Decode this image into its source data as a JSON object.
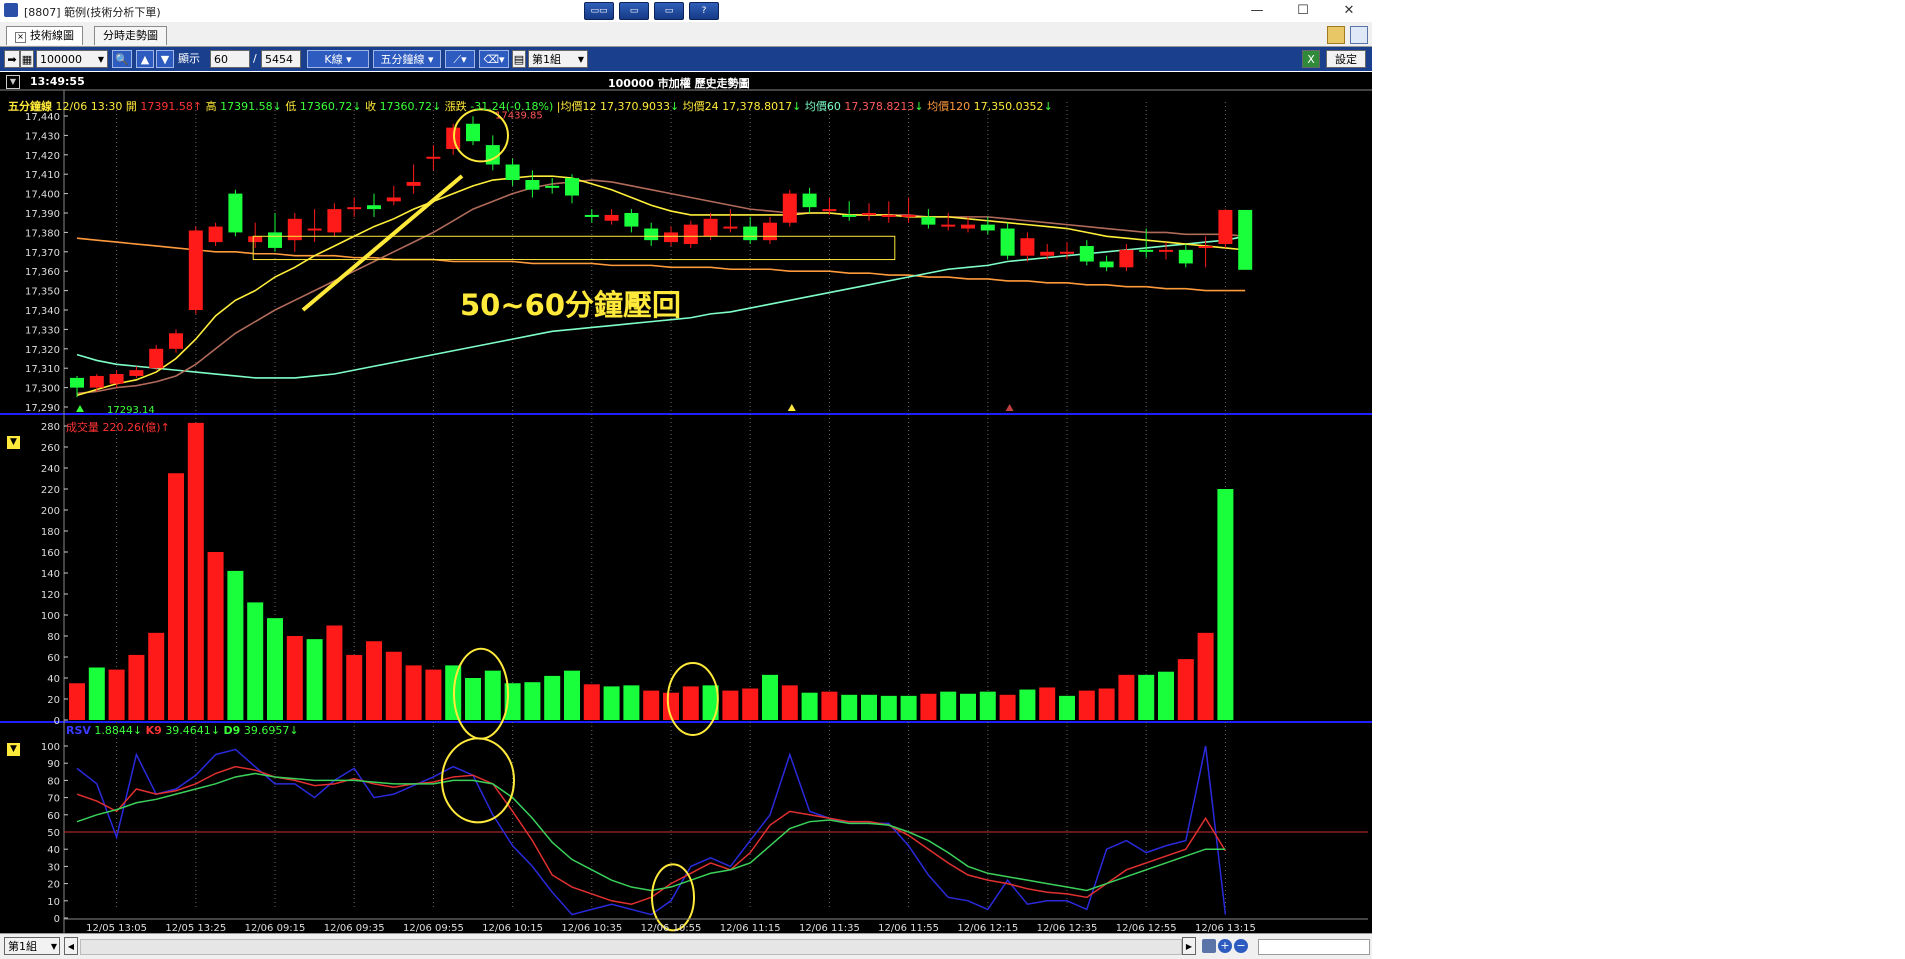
{
  "window": {
    "title": "[8807] 範例(技術分析下單)"
  },
  "title_buttons": [
    "▭▭",
    "▭",
    "▭",
    "?"
  ],
  "tabs": [
    "技術線圖",
    "分時走勢圖"
  ],
  "toolbar": {
    "symbol": "100000",
    "display_label": "顯示",
    "display_value": "60",
    "total_value": "5454",
    "kline_label": "K線",
    "period_label": "五分鐘線",
    "group_label": "第1組",
    "settings_label": "設定"
  },
  "chart_header": {
    "time": "13:49:55",
    "title": "100000 市加權  歷史走勢圖"
  },
  "price_info": {
    "period": "五分鐘線",
    "datetime": "12/06 13:30",
    "open_label": "開",
    "open": "17391.58",
    "high_label": "高",
    "high": "17391.58",
    "low_label": "低",
    "low": "17360.72",
    "close_label": "收",
    "close": "17360.72",
    "change_label": "漲跌",
    "change": "-31.24(-0.18%)",
    "ma12_label": "均價12",
    "ma12": "17,370.9033",
    "ma24_label": "均價24",
    "ma24": "17,378.8017",
    "ma60_label": "均價60",
    "ma60": "17,378.8213",
    "ma120_label": "均價120",
    "ma120": "17,350.0352"
  },
  "annotation_text": "50~60分鐘壓回",
  "volume_info": {
    "label": "成交量",
    "value": "220.26(億)"
  },
  "kd_info": {
    "rsv_label": "RSV",
    "rsv": "1.8844",
    "k_label": "K9",
    "k": "39.4641",
    "d_label": "D9",
    "d": "39.6957"
  },
  "colors": {
    "up": "#ff1a1a",
    "down": "#1aff3c",
    "ma12": "#ffef3a",
    "ma24": "#b06a5a",
    "ma60": "#7fffc8",
    "ma120": "#ff9a3c",
    "rsv": "#2a2adc",
    "k": "#e03030",
    "d": "#3ad05a",
    "annotation": "#ffe93a"
  },
  "bottom": {
    "group_label": "第1組"
  },
  "chart_data": [
    {
      "type": "candlestick",
      "title": "100000 市加權  歷史走勢圖",
      "ylim": [
        17290,
        17440
      ],
      "yticks": [
        17290,
        17300,
        17310,
        17320,
        17330,
        17340,
        17350,
        17360,
        17370,
        17380,
        17390,
        17400,
        17410,
        17420,
        17430,
        17440
      ],
      "xtick_labels": [
        "12/05 13:05",
        "12/05 13:25",
        "12/06 09:15",
        "12/06 09:35",
        "12/06 09:55",
        "12/06 10:15",
        "12/06 10:35",
        "12/06 10:55",
        "12/06 11:15",
        "12/06 11:35",
        "12/06 11:55",
        "12/06 12:15",
        "12/06 12:35",
        "12/06 12:55",
        "12/06 13:15"
      ],
      "xtick_at": [
        2,
        6,
        10,
        14,
        18,
        22,
        26,
        30,
        34,
        38,
        42,
        46,
        50,
        54,
        58
      ],
      "value_labels": {
        "high": "17439.85",
        "low": "17293.14"
      },
      "candles": [
        [
          17305,
          17300,
          17306,
          17295
        ],
        [
          17300,
          17306,
          17307,
          17298
        ],
        [
          17302,
          17307,
          17309,
          17300
        ],
        [
          17306,
          17309,
          17311,
          17305
        ],
        [
          17310,
          17320,
          17322,
          17309
        ],
        [
          17320,
          17328,
          17330,
          17318
        ],
        [
          17340,
          17381,
          17383,
          17338
        ],
        [
          17375,
          17383,
          17385,
          17373
        ],
        [
          17400,
          17380,
          17402,
          17378
        ],
        [
          17375,
          17378,
          17385,
          17372
        ],
        [
          17380,
          17372,
          17390,
          17370
        ],
        [
          17376,
          17387,
          17390,
          17370
        ],
        [
          17382,
          17382,
          17392,
          17375
        ],
        [
          17380,
          17392,
          17395,
          17378
        ],
        [
          17392,
          17393,
          17398,
          17388
        ],
        [
          17394,
          17392,
          17400,
          17388
        ],
        [
          17396,
          17398,
          17404,
          17394
        ],
        [
          17404,
          17406,
          17415,
          17400
        ],
        [
          17418,
          17419,
          17425,
          17412
        ],
        [
          17423,
          17434,
          17436,
          17420
        ],
        [
          17436,
          17427,
          17439.85,
          17425
        ],
        [
          17425,
          17415,
          17430,
          17412
        ],
        [
          17415,
          17407,
          17418,
          17404
        ],
        [
          17407,
          17402,
          17412,
          17398
        ],
        [
          17404,
          17403,
          17408,
          17400
        ],
        [
          17408,
          17399,
          17410,
          17395
        ],
        [
          17389,
          17388,
          17392,
          17385
        ],
        [
          17386,
          17389,
          17392,
          17384
        ],
        [
          17390,
          17383,
          17392,
          17380
        ],
        [
          17382,
          17376,
          17385,
          17373
        ],
        [
          17375,
          17380,
          17383,
          17373
        ],
        [
          17374,
          17384,
          17386,
          17372
        ],
        [
          17378,
          17387,
          17390,
          17376
        ],
        [
          17383,
          17383,
          17392,
          17380
        ],
        [
          17383,
          17376,
          17388,
          17374
        ],
        [
          17376,
          17385,
          17388,
          17374
        ],
        [
          17385,
          17400,
          17402,
          17383
        ],
        [
          17400,
          17393,
          17403,
          17390
        ],
        [
          17392,
          17392,
          17398,
          17389
        ],
        [
          17389,
          17388,
          17396,
          17386
        ],
        [
          17390,
          17390,
          17395,
          17386
        ],
        [
          17388,
          17389,
          17396,
          17385
        ],
        [
          17389,
          17389,
          17398,
          17385
        ],
        [
          17388,
          17384,
          17392,
          17382
        ],
        [
          17384,
          17384,
          17390,
          17381
        ],
        [
          17382,
          17384,
          17388,
          17380
        ],
        [
          17384,
          17381,
          17388,
          17379
        ],
        [
          17382,
          17368,
          17385,
          17366
        ],
        [
          17368,
          17377,
          17380,
          17365
        ],
        [
          17368,
          17370,
          17374,
          17366
        ],
        [
          17369,
          17370,
          17375,
          17366
        ],
        [
          17373,
          17365,
          17376,
          17363
        ],
        [
          17365,
          17362,
          17368,
          17360
        ],
        [
          17362,
          17371,
          17374,
          17360
        ],
        [
          17371,
          17370,
          17382,
          17367
        ],
        [
          17370,
          17371,
          17375,
          17366
        ],
        [
          17371,
          17364,
          17374,
          17362
        ],
        [
          17373,
          17373,
          17378,
          17362
        ],
        [
          17374,
          17391.58,
          17392,
          17372
        ],
        [
          17391.58,
          17360.72,
          17391.58,
          17360.72
        ]
      ],
      "ma12": [
        17296,
        17299,
        17302,
        17304,
        17308,
        17315,
        17325,
        17337,
        17345,
        17350,
        17357,
        17362,
        17368,
        17373,
        17378,
        17383,
        17387,
        17392,
        17396,
        17400,
        17404,
        17407,
        17408,
        17409,
        17409,
        17408,
        17405,
        17402,
        17398,
        17394,
        17391,
        17389,
        17389,
        17389,
        17389,
        17389,
        17389,
        17390,
        17390,
        17389,
        17389,
        17389,
        17388,
        17388,
        17388,
        17387,
        17386,
        17385,
        17384,
        17383,
        17382,
        17380,
        17378,
        17377,
        17376,
        17375,
        17374,
        17373,
        17372,
        17371
      ],
      "ma24": [
        17297,
        17298,
        17300,
        17301,
        17303,
        17306,
        17312,
        17320,
        17328,
        17334,
        17340,
        17345,
        17350,
        17355,
        17360,
        17365,
        17370,
        17375,
        17380,
        17386,
        17392,
        17396,
        17400,
        17403,
        17405,
        17406,
        17407,
        17406,
        17404,
        17402,
        17400,
        17398,
        17396,
        17394,
        17392,
        17391,
        17390,
        17390,
        17390,
        17389,
        17389,
        17389,
        17389,
        17388,
        17388,
        17388,
        17388,
        17387,
        17386,
        17385,
        17384,
        17383,
        17382,
        17381,
        17380,
        17380,
        17379,
        17379,
        17379,
        17378
      ],
      "ma60": [
        17317,
        17314,
        17312,
        17311,
        17310,
        17309,
        17308,
        17307,
        17306,
        17305,
        17305,
        17305,
        17306,
        17307,
        17309,
        17311,
        17313,
        17315,
        17317,
        17319,
        17321,
        17323,
        17325,
        17327,
        17329,
        17330,
        17331,
        17332,
        17333,
        17334,
        17335,
        17336,
        17338,
        17339,
        17341,
        17343,
        17345,
        17347,
        17349,
        17351,
        17353,
        17355,
        17357,
        17359,
        17361,
        17362,
        17363,
        17365,
        17366,
        17367,
        17368,
        17369,
        17370,
        17371,
        17372,
        17373,
        17374,
        17375,
        17376,
        17378
      ],
      "ma120": [
        17377,
        17376,
        17375,
        17374,
        17373,
        17372,
        17371,
        17370,
        17370,
        17369,
        17369,
        17368,
        17368,
        17368,
        17367,
        17367,
        17366,
        17366,
        17366,
        17365,
        17365,
        17365,
        17365,
        17364,
        17364,
        17364,
        17364,
        17363,
        17363,
        17363,
        17362,
        17362,
        17362,
        17361,
        17361,
        17361,
        17360,
        17360,
        17360,
        17359,
        17359,
        17358,
        17358,
        17357,
        17357,
        17356,
        17356,
        17355,
        17355,
        17354,
        17354,
        17353,
        17353,
        17352,
        17352,
        17351,
        17351,
        17350,
        17350,
        17350
      ]
    },
    {
      "type": "bar",
      "title": "成交量",
      "ylim": [
        0,
        280
      ],
      "yticks": [
        0,
        20,
        40,
        60,
        80,
        100,
        120,
        140,
        160,
        180,
        200,
        220,
        240,
        260,
        280
      ],
      "values": [
        35,
        50,
        48,
        62,
        83,
        235,
        283,
        160,
        142,
        112,
        97,
        80,
        77,
        90,
        62,
        75,
        65,
        52,
        48,
        52,
        40,
        47,
        35,
        36,
        42,
        47,
        34,
        32,
        33,
        28,
        26,
        32,
        33,
        28,
        30,
        43,
        33,
        26,
        27,
        24,
        24,
        23,
        23,
        25,
        27,
        25,
        27,
        24,
        29,
        31,
        23,
        28,
        30,
        43,
        43,
        46,
        58,
        83,
        220
      ],
      "up": [
        true,
        false,
        true,
        true,
        true,
        true,
        true,
        true,
        false,
        false,
        false,
        true,
        false,
        true,
        true,
        true,
        true,
        true,
        true,
        false,
        false,
        false,
        false,
        false,
        false,
        false,
        true,
        false,
        false,
        true,
        true,
        true,
        false,
        true,
        true,
        false,
        true,
        false,
        true,
        false,
        false,
        false,
        false,
        true,
        false,
        false,
        false,
        true,
        false,
        true,
        false,
        true,
        true,
        true,
        false,
        false,
        true,
        true,
        false
      ]
    },
    {
      "type": "line",
      "title": "KD",
      "ylim": [
        0,
        100
      ],
      "yticks": [
        0,
        10,
        20,
        30,
        40,
        50,
        60,
        70,
        80,
        90,
        100
      ],
      "reference_line": 50,
      "series": [
        {
          "name": "RSV",
          "values": [
            87,
            78,
            47,
            95,
            72,
            75,
            83,
            95,
            98,
            88,
            78,
            78,
            70,
            80,
            87,
            70,
            72,
            77,
            82,
            88,
            83,
            60,
            42,
            30,
            15,
            2,
            5,
            8,
            5,
            2,
            10,
            30,
            35,
            30,
            45,
            60,
            95,
            62,
            58,
            55,
            55,
            55,
            42,
            25,
            12,
            10,
            5,
            22,
            8,
            10,
            10,
            5,
            40,
            45,
            38,
            42,
            45,
            100,
            2
          ]
        },
        {
          "name": "K9",
          "values": [
            72,
            68,
            62,
            75,
            72,
            74,
            78,
            84,
            88,
            86,
            82,
            80,
            77,
            78,
            81,
            78,
            76,
            78,
            79,
            82,
            83,
            78,
            62,
            45,
            25,
            18,
            14,
            10,
            8,
            12,
            20,
            26,
            32,
            28,
            38,
            54,
            62,
            60,
            58,
            56,
            56,
            54,
            48,
            40,
            32,
            25,
            22,
            20,
            17,
            15,
            14,
            12,
            20,
            28,
            32,
            36,
            40,
            58,
            39
          ]
        },
        {
          "name": "D9",
          "values": [
            56,
            60,
            63,
            67,
            69,
            72,
            75,
            78,
            82,
            84,
            82,
            81,
            80,
            80,
            80,
            79,
            78,
            78,
            78,
            80,
            80,
            78,
            70,
            58,
            44,
            34,
            28,
            22,
            18,
            16,
            18,
            22,
            26,
            28,
            32,
            42,
            52,
            56,
            57,
            55,
            55,
            54,
            50,
            45,
            38,
            30,
            26,
            24,
            22,
            20,
            18,
            16,
            20,
            24,
            28,
            32,
            36,
            40,
            40
          ]
        }
      ]
    }
  ]
}
